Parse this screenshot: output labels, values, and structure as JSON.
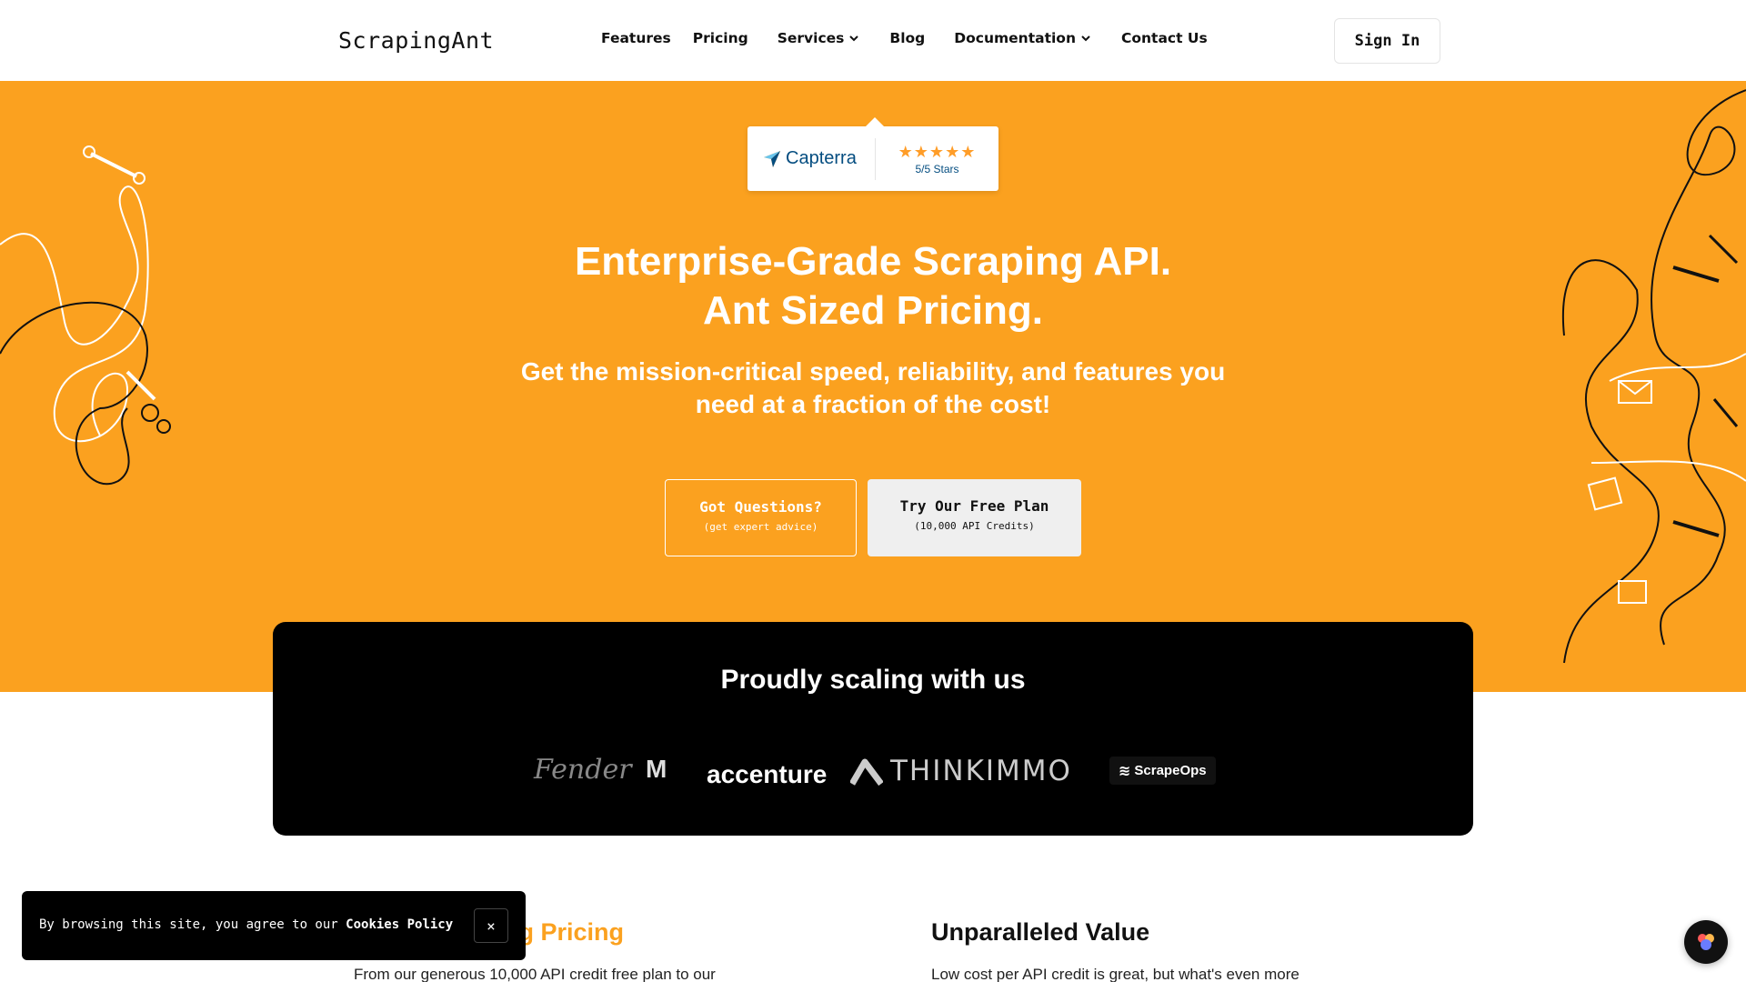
{
  "brand": {
    "logo": "ScrapingAnt"
  },
  "nav": {
    "items": [
      {
        "label": "Features"
      },
      {
        "label": "Pricing"
      },
      {
        "label": "Services"
      },
      {
        "label": "Blog"
      },
      {
        "label": "Documentation"
      },
      {
        "label": "Contact Us"
      }
    ],
    "signin": "Sign In"
  },
  "capterra": {
    "name": "Capterra",
    "stars": "★★★★★",
    "rating": "5/5 Stars"
  },
  "hero": {
    "title_line1": "Enterprise-Grade Scraping API.",
    "title_line2": "Ant Sized Pricing.",
    "subtitle_line1": "Get the mission-critical speed, reliability, and features you",
    "subtitle_line2": "need at a fraction of the cost!",
    "btn_questions": "Got Questions?",
    "btn_questions_sub": "(get expert advice)",
    "btn_free": "Try Our Free Plan",
    "btn_free_sub": "(10,000 API Credits)",
    "color": "#FBA11F"
  },
  "partners": {
    "title": "Proudly scaling with us",
    "logos": [
      "Fender",
      "M",
      "accenture",
      "THINKIMMO",
      "ScrapeOps"
    ]
  },
  "features": [
    {
      "title": "ng Pricing",
      "text": "From our generous 10,000 API credit free plan to our"
    },
    {
      "title": "Unparalleled Value",
      "text": "Low cost per API credit is great, but what's even more"
    }
  ],
  "cookie": {
    "text": "By browsing this site, you agree to our ",
    "link": "Cookies Policy",
    "close": "×"
  }
}
